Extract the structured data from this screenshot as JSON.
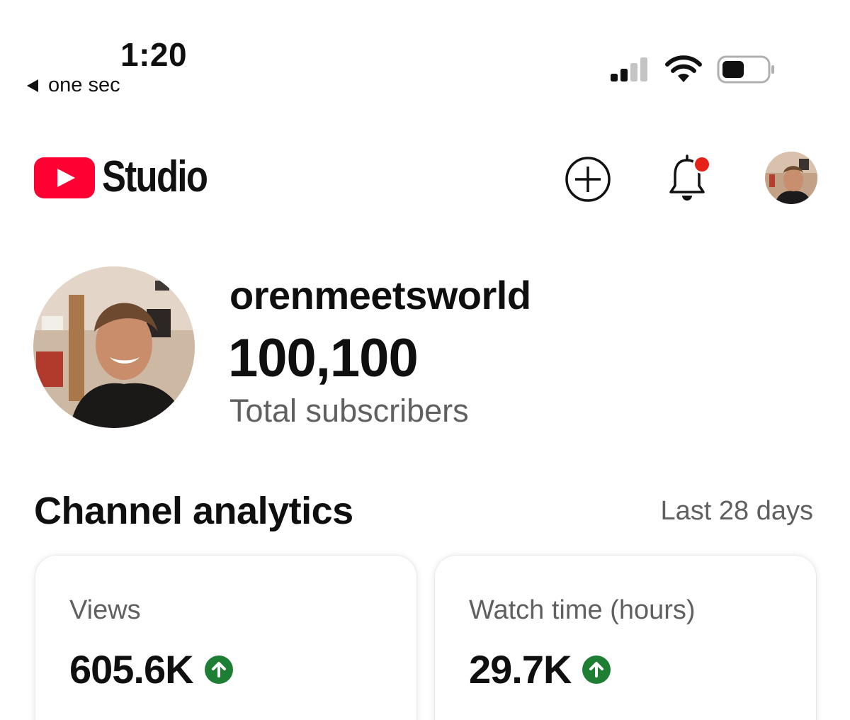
{
  "status_bar": {
    "time": "1:20",
    "back_app": "one sec",
    "icons": [
      "cellular-signal-icon",
      "wifi-icon",
      "battery-icon"
    ]
  },
  "header": {
    "logo_text": "Studio",
    "icons": [
      "youtube-logo-icon",
      "create-plus-icon",
      "notifications-bell-icon",
      "account-avatar"
    ],
    "notification_dot_color": "#e62117",
    "brand_color": "#ff0033"
  },
  "channel": {
    "name": "orenmeetsworld",
    "subscribers": "100,100",
    "subscribers_label": "Total subscribers"
  },
  "analytics": {
    "title": "Channel analytics",
    "period": "Last 28 days",
    "cards": [
      {
        "label": "Views",
        "value": "605.6K",
        "trend": "up"
      },
      {
        "label": "Watch time (hours)",
        "value": "29.7K",
        "trend": "up"
      }
    ],
    "trend_color": "#1e7e34"
  }
}
